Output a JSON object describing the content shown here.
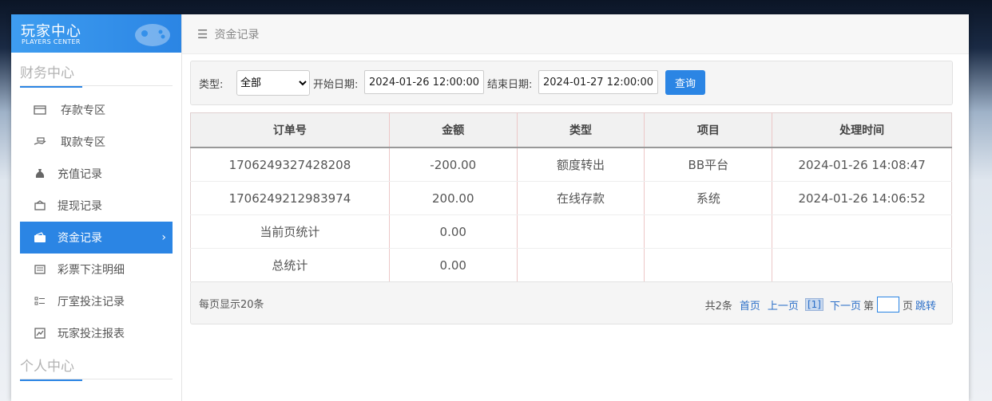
{
  "logo": {
    "title_cn": "玩家中心",
    "title_en": "PLAYERS CENTER"
  },
  "sidebar": {
    "finance_title": "财务中心",
    "personal_title": "个人中心",
    "items": [
      {
        "label": "存款专区",
        "icon": "card-icon"
      },
      {
        "label": "取款专区",
        "icon": "hand-money-icon"
      },
      {
        "label": "充值记录",
        "icon": "money-bag-icon"
      },
      {
        "label": "提现记录",
        "icon": "withdraw-icon"
      },
      {
        "label": "资金记录",
        "icon": "wallet-icon",
        "active": true,
        "chevron": "›"
      },
      {
        "label": "彩票下注明细",
        "icon": "list-icon"
      },
      {
        "label": "厅室投注记录",
        "icon": "list-bullets-icon"
      },
      {
        "label": "玩家投注报表",
        "icon": "chart-icon"
      }
    ]
  },
  "topbar": {
    "menu_icon": "☰",
    "breadcrumb": "资金记录"
  },
  "filter": {
    "type_label": "类型:",
    "type_value": "全部",
    "start_label": "开始日期:",
    "start_value": "2024-01-26 12:00:00",
    "end_label": "结束日期:",
    "end_value": "2024-01-27 12:00:00",
    "query_button": "查询"
  },
  "table": {
    "headers": [
      "订单号",
      "金额",
      "类型",
      "项目",
      "处理时间"
    ],
    "rows": [
      [
        "1706249327428208",
        "-200.00",
        "额度转出",
        "BB平台",
        "2024-01-26 14:08:47"
      ],
      [
        "1706249212983974",
        "200.00",
        "在线存款",
        "系统",
        "2024-01-26 14:06:52"
      ],
      [
        "当前页统计",
        "0.00",
        "",
        "",
        ""
      ],
      [
        "总统计",
        "0.00",
        "",
        "",
        ""
      ]
    ]
  },
  "pager": {
    "per_page": "每页显示20条",
    "total": "共2条",
    "first": "首页",
    "prev": "上一页",
    "current": "[1]",
    "next": "下一页",
    "page_prefix": "第",
    "page_suffix": "页",
    "jump": "跳转"
  },
  "colors": {
    "accent": "#2b85e4"
  }
}
